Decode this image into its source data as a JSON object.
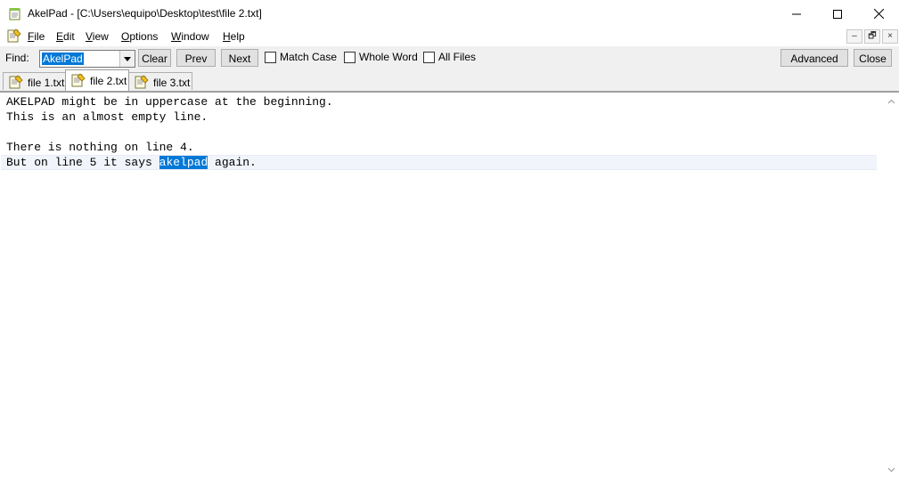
{
  "window": {
    "title": "AkelPad - [C:\\Users\\equipo\\Desktop\\test\\file 2.txt]",
    "icons": {
      "app": "akelpad-notepad-icon",
      "minimize": "minimize-icon",
      "maximize": "maximize-icon",
      "close": "close-icon"
    }
  },
  "menu": {
    "items": [
      {
        "acc": "F",
        "rest": "ile"
      },
      {
        "acc": "E",
        "rest": "dit"
      },
      {
        "acc": "V",
        "rest": "iew"
      },
      {
        "acc": "O",
        "rest": "ptions"
      },
      {
        "acc": "W",
        "rest": "indow"
      },
      {
        "acc": "H",
        "rest": "elp"
      }
    ],
    "mdi_buttons": {
      "minimize": "–",
      "restore": "🗗",
      "close": "×"
    }
  },
  "findbar": {
    "label": "Find:",
    "value": "AkelPad",
    "buttons": {
      "clear": "Clear",
      "prev": "Prev",
      "next": "Next",
      "advanced": "Advanced",
      "close": "Close"
    },
    "options": [
      {
        "label": "Match Case",
        "checked": false
      },
      {
        "label": "Whole Word",
        "checked": false
      },
      {
        "label": "All Files",
        "checked": false
      }
    ]
  },
  "tabs": [
    {
      "label": "file 1.txt",
      "active": false
    },
    {
      "label": "file 2.txt",
      "active": true
    },
    {
      "label": "file 3.txt",
      "active": false
    }
  ],
  "editor": {
    "lines": [
      {
        "text": "AKELPAD might be in uppercase at the beginning."
      },
      {
        "text": "This is an almost empty line."
      },
      {
        "text": ""
      },
      {
        "text": "There is nothing on line 4."
      },
      {
        "before": "But on line 5 it says ",
        "match": "akelpad",
        "after": " again."
      }
    ],
    "current_line": 5
  },
  "colors": {
    "selection": "#0078d7",
    "current_line": "#f1f5fb"
  }
}
